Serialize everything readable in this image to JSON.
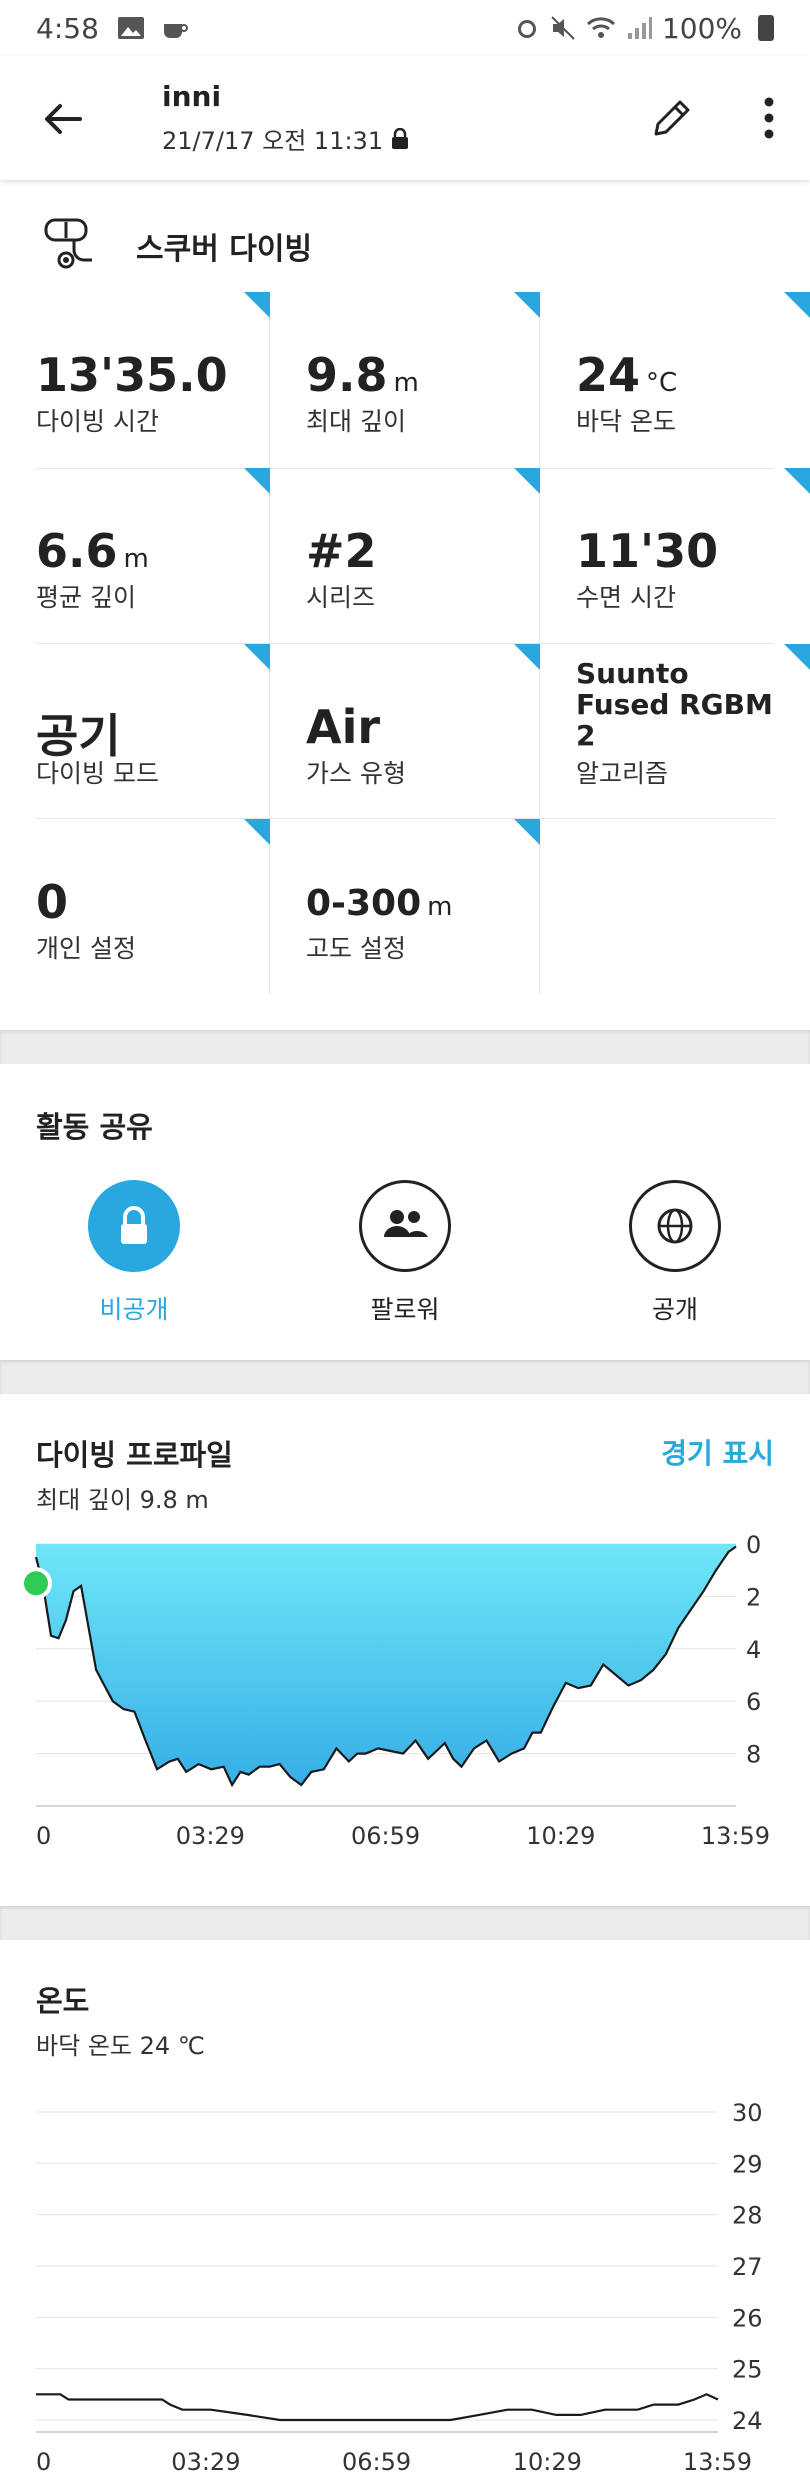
{
  "status_bar": {
    "time": "4:58",
    "battery": "100%"
  },
  "header": {
    "title": "inni",
    "datetime": "21/7/17 오전 11:31"
  },
  "activity": {
    "name": "스쿠버 다이빙"
  },
  "stats": [
    {
      "value": "13'35.0",
      "unit": "",
      "label": "다이빙 시간"
    },
    {
      "value": "9.8",
      "unit": "m",
      "label": "최대 깊이"
    },
    {
      "value": "24",
      "unit": "°C",
      "label": "바닥 온도"
    },
    {
      "value": "6.6",
      "unit": "m",
      "label": "평균 깊이"
    },
    {
      "value": "#2",
      "unit": "",
      "label": "시리즈"
    },
    {
      "value": "11'30",
      "unit": "",
      "label": "수면 시간"
    },
    {
      "value": "공기",
      "unit": "",
      "label": "다이빙 모드"
    },
    {
      "value": "Air",
      "unit": "",
      "label": "가스 유형"
    },
    {
      "value": "Suunto Fused RGBM 2",
      "unit": "",
      "label": "알고리즘"
    },
    {
      "value": "0",
      "unit": "",
      "label": "개인 설정"
    },
    {
      "value": "0-300",
      "unit": "m",
      "label": "고도 설정"
    }
  ],
  "sharing": {
    "title": "활동 공유",
    "options": [
      {
        "label": "비공개",
        "icon": "lock-icon",
        "selected": true
      },
      {
        "label": "팔로워",
        "icon": "followers-icon",
        "selected": false
      },
      {
        "label": "공개",
        "icon": "globe-icon",
        "selected": false
      }
    ]
  },
  "profile": {
    "title": "다이빙 프로파일",
    "link": "경기 표시",
    "subtitle": "최대 깊이 9.8 m"
  },
  "temperature": {
    "title": "온도",
    "subtitle": "바닥 온도 24 ℃"
  },
  "colors": {
    "accent": "#29a8e0",
    "start_dot": "#2ecc55"
  },
  "chart_data": [
    {
      "type": "area",
      "x_ticks": [
        "0",
        "03:29",
        "06:59",
        "10:29",
        "13:59"
      ],
      "y_ticks": [
        "0",
        "2",
        "4",
        "6",
        "8"
      ],
      "ylim": [
        0,
        10
      ],
      "y_inverted": true,
      "xlim_seconds": [
        0,
        839
      ],
      "x": [
        0,
        8,
        18,
        27,
        36,
        45,
        54,
        63,
        72,
        82,
        92,
        105,
        118,
        130,
        145,
        160,
        170,
        180,
        195,
        210,
        225,
        235,
        245,
        255,
        268,
        280,
        292,
        305,
        318,
        330,
        345,
        360,
        375,
        385,
        395,
        410,
        425,
        440,
        455,
        470,
        480,
        490,
        500,
        510,
        525,
        540,
        555,
        570,
        585,
        595,
        605,
        620,
        635,
        650,
        665,
        680,
        695,
        710,
        725,
        740,
        755,
        770,
        785,
        800,
        815,
        830,
        839
      ],
      "values": [
        0.5,
        1.5,
        3.5,
        3.6,
        2.9,
        1.8,
        1.6,
        3.2,
        4.8,
        5.4,
        6.0,
        6.3,
        6.4,
        7.4,
        8.6,
        8.3,
        8.2,
        8.7,
        8.4,
        8.6,
        8.5,
        9.2,
        8.7,
        8.8,
        8.5,
        8.5,
        8.4,
        8.9,
        9.2,
        8.7,
        8.6,
        7.8,
        8.3,
        8.0,
        8.0,
        7.8,
        7.9,
        8.0,
        7.5,
        8.2,
        7.9,
        7.6,
        8.2,
        8.5,
        7.8,
        7.5,
        8.3,
        8.0,
        7.8,
        7.2,
        7.2,
        6.2,
        5.3,
        5.5,
        5.4,
        4.6,
        5.0,
        5.4,
        5.2,
        4.8,
        4.2,
        3.2,
        2.5,
        1.8,
        1.0,
        0.3,
        0.1
      ]
    },
    {
      "type": "line",
      "x_ticks": [
        "0",
        "03:29",
        "06:59",
        "10:29",
        "13:59"
      ],
      "y_ticks": [
        "30",
        "29",
        "28",
        "27",
        "26",
        "25",
        "24"
      ],
      "ylim": [
        24,
        30
      ],
      "xlim_seconds": [
        0,
        839
      ],
      "x": [
        0,
        30,
        40,
        100,
        155,
        165,
        180,
        215,
        260,
        300,
        330,
        365,
        400,
        445,
        510,
        545,
        580,
        610,
        640,
        670,
        700,
        725,
        740,
        760,
        790,
        810,
        825,
        839
      ],
      "values": [
        24.5,
        24.5,
        24.4,
        24.4,
        24.4,
        24.3,
        24.2,
        24.2,
        24.1,
        24.0,
        24.0,
        24.0,
        24.0,
        24.0,
        24.0,
        24.1,
        24.2,
        24.2,
        24.1,
        24.1,
        24.2,
        24.2,
        24.2,
        24.3,
        24.3,
        24.4,
        24.5,
        24.4
      ]
    }
  ]
}
